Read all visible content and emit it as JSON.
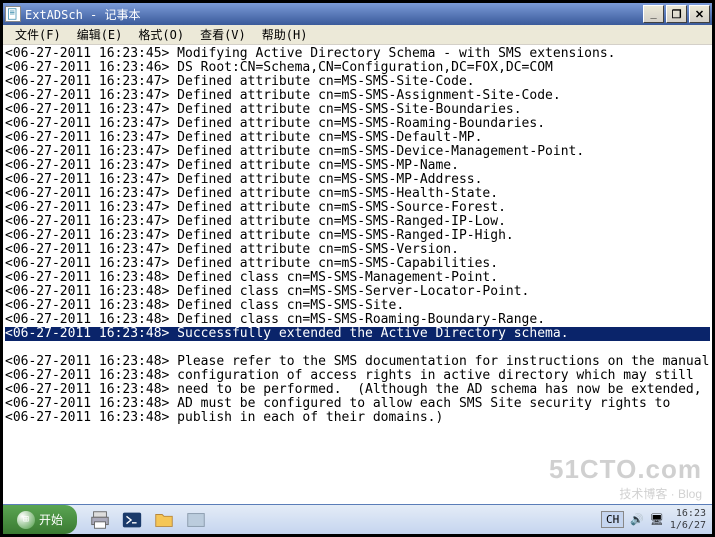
{
  "window": {
    "title": "ExtADSch - 记事本"
  },
  "menu": {
    "file": "文件(F)",
    "edit": "编辑(E)",
    "format": "格式(O)",
    "view": "查看(V)",
    "help": "帮助(H)"
  },
  "log": {
    "lines": [
      {
        "ts": "<06-27-2011 16:23:45>",
        "msg": "Modifying Active Directory Schema - with SMS extensions.",
        "sel": false
      },
      {
        "ts": "<06-27-2011 16:23:46>",
        "msg": "DS Root:CN=Schema,CN=Configuration,DC=FOX,DC=COM",
        "sel": false
      },
      {
        "ts": "<06-27-2011 16:23:47>",
        "msg": "Defined attribute cn=MS-SMS-Site-Code.",
        "sel": false
      },
      {
        "ts": "<06-27-2011 16:23:47>",
        "msg": "Defined attribute cn=mS-SMS-Assignment-Site-Code.",
        "sel": false
      },
      {
        "ts": "<06-27-2011 16:23:47>",
        "msg": "Defined attribute cn=MS-SMS-Site-Boundaries.",
        "sel": false
      },
      {
        "ts": "<06-27-2011 16:23:47>",
        "msg": "Defined attribute cn=MS-SMS-Roaming-Boundaries.",
        "sel": false
      },
      {
        "ts": "<06-27-2011 16:23:47>",
        "msg": "Defined attribute cn=MS-SMS-Default-MP.",
        "sel": false
      },
      {
        "ts": "<06-27-2011 16:23:47>",
        "msg": "Defined attribute cn=mS-SMS-Device-Management-Point.",
        "sel": false
      },
      {
        "ts": "<06-27-2011 16:23:47>",
        "msg": "Defined attribute cn=MS-SMS-MP-Name.",
        "sel": false
      },
      {
        "ts": "<06-27-2011 16:23:47>",
        "msg": "Defined attribute cn=MS-SMS-MP-Address.",
        "sel": false
      },
      {
        "ts": "<06-27-2011 16:23:47>",
        "msg": "Defined attribute cn=mS-SMS-Health-State.",
        "sel": false
      },
      {
        "ts": "<06-27-2011 16:23:47>",
        "msg": "Defined attribute cn=mS-SMS-Source-Forest.",
        "sel": false
      },
      {
        "ts": "<06-27-2011 16:23:47>",
        "msg": "Defined attribute cn=MS-SMS-Ranged-IP-Low.",
        "sel": false
      },
      {
        "ts": "<06-27-2011 16:23:47>",
        "msg": "Defined attribute cn=MS-SMS-Ranged-IP-High.",
        "sel": false
      },
      {
        "ts": "<06-27-2011 16:23:47>",
        "msg": "Defined attribute cn=mS-SMS-Version.",
        "sel": false
      },
      {
        "ts": "<06-27-2011 16:23:47>",
        "msg": "Defined attribute cn=mS-SMS-Capabilities.",
        "sel": false
      },
      {
        "ts": "<06-27-2011 16:23:48>",
        "msg": "Defined class cn=MS-SMS-Management-Point.",
        "sel": false
      },
      {
        "ts": "<06-27-2011 16:23:48>",
        "msg": "Defined class cn=MS-SMS-Server-Locator-Point.",
        "sel": false
      },
      {
        "ts": "<06-27-2011 16:23:48>",
        "msg": "Defined class cn=MS-SMS-Site.",
        "sel": false
      },
      {
        "ts": "<06-27-2011 16:23:48>",
        "msg": "Defined class cn=MS-SMS-Roaming-Boundary-Range.",
        "sel": false
      },
      {
        "ts": "<06-27-2011 16:23:48>",
        "msg": "Successfully extended the Active Directory schema.",
        "sel": true
      },
      {
        "ts": "",
        "msg": "",
        "sel": false
      },
      {
        "ts": "<06-27-2011 16:23:48>",
        "msg": "Please refer to the SMS documentation for instructions on the manual",
        "sel": false
      },
      {
        "ts": "<06-27-2011 16:23:48>",
        "msg": "configuration of access rights in active directory which may still",
        "sel": false
      },
      {
        "ts": "<06-27-2011 16:23:48>",
        "msg": "need to be performed.  (Although the AD schema has now be extended,",
        "sel": false
      },
      {
        "ts": "<06-27-2011 16:23:48>",
        "msg": "AD must be configured to allow each SMS Site security rights to",
        "sel": false
      },
      {
        "ts": "<06-27-2011 16:23:48>",
        "msg": "publish in each of their domains.)",
        "sel": false
      }
    ]
  },
  "taskbar": {
    "start": "开始",
    "lang": "CH",
    "time": "16:23",
    "date": "1/6/27"
  },
  "watermark": {
    "big": "51CTO.com",
    "small": "技术博客 · Blog"
  },
  "winbtns": {
    "min": "_",
    "restore": "❐",
    "close": "✕"
  }
}
